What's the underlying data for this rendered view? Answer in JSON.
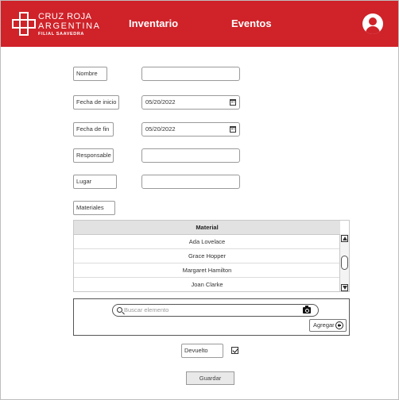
{
  "header": {
    "logo": {
      "line1": "CRUZ ROJA",
      "line2": "ARGENTINA",
      "line3": "FILIAL SAAVEDRA"
    },
    "nav": {
      "inventario": "Inventario",
      "eventos": "Eventos"
    },
    "user_icon": "user-circle-icon",
    "brand_color": "#cf2229"
  },
  "form": {
    "nombre": {
      "label": "Nombre",
      "value": ""
    },
    "fecha_inicio": {
      "label": "Fecha de inicio",
      "value": "05/20/2022"
    },
    "fecha_fin": {
      "label": "Fecha de fin",
      "value": "05/20/2022"
    },
    "responsable": {
      "label": "Responsable",
      "value": ""
    },
    "lugar": {
      "label": "Lugar",
      "value": ""
    },
    "materiales": {
      "label": "Materiales"
    }
  },
  "table": {
    "header": "Material",
    "rows": [
      "Ada Lovelace",
      "Grace Hopper",
      "Margaret Hamilton",
      "Joan Clarke"
    ]
  },
  "add_panel": {
    "search_placeholder": "Buscar elemento",
    "add_label": "Agregar"
  },
  "devuelto": {
    "label": "Devuelto",
    "checked": true
  },
  "save_label": "Guardar"
}
